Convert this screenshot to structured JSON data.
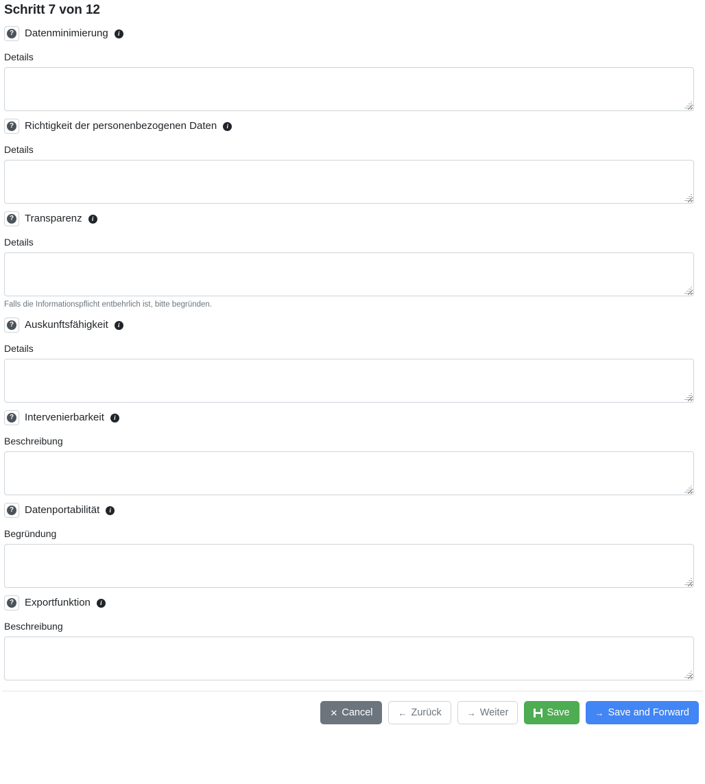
{
  "page": {
    "step_title": "Schritt 7 von 12"
  },
  "icons": {
    "help_glyph": "?",
    "info_glyph": "i"
  },
  "sections": [
    {
      "id": "datenminimierung",
      "title": "Datenminimierung",
      "field_label": "Details",
      "value": "",
      "placeholder": "",
      "help_text": ""
    },
    {
      "id": "richtigkeit-der-personenbezogenen-daten",
      "title": "Richtigkeit der personenbezogenen Daten",
      "field_label": "Details",
      "value": "",
      "placeholder": "",
      "help_text": ""
    },
    {
      "id": "transparenz",
      "title": "Transparenz",
      "field_label": "Details",
      "value": "",
      "placeholder": "",
      "help_text": "Falls die Informationspflicht entbehrlich ist, bitte begründen."
    },
    {
      "id": "auskunftsfaehigkeit",
      "title": "Auskunftsfähigkeit",
      "field_label": "Details",
      "value": "",
      "placeholder": "",
      "help_text": ""
    },
    {
      "id": "intervenierbarkeit",
      "title": "Intervenierbarkeit",
      "field_label": "Beschreibung",
      "value": "",
      "placeholder": "",
      "help_text": ""
    },
    {
      "id": "datenportabilitaet",
      "title": "Datenportabilität",
      "field_label": "Begründung",
      "value": "",
      "placeholder": "",
      "help_text": ""
    },
    {
      "id": "exportfunktion",
      "title": "Exportfunktion",
      "field_label": "Beschreibung",
      "value": "",
      "placeholder": "",
      "help_text": ""
    }
  ],
  "footer": {
    "buttons": [
      {
        "id": "cancel",
        "label": "Cancel",
        "icon": "✕",
        "style": "secondary"
      },
      {
        "id": "back",
        "label": "Zurück",
        "icon": "←",
        "style": "outline"
      },
      {
        "id": "next",
        "label": "Weiter",
        "icon": "→",
        "style": "outline"
      },
      {
        "id": "save",
        "label": "Save",
        "icon": "floppy",
        "style": "success"
      },
      {
        "id": "save-and-forward",
        "label": "Save and Forward",
        "icon": "→",
        "style": "primary"
      }
    ]
  },
  "colors": {
    "secondary": "#6c757d",
    "success": "#4eac52",
    "primary": "#4285f4",
    "border": "#ced4da",
    "muted_text": "#6c757d"
  }
}
